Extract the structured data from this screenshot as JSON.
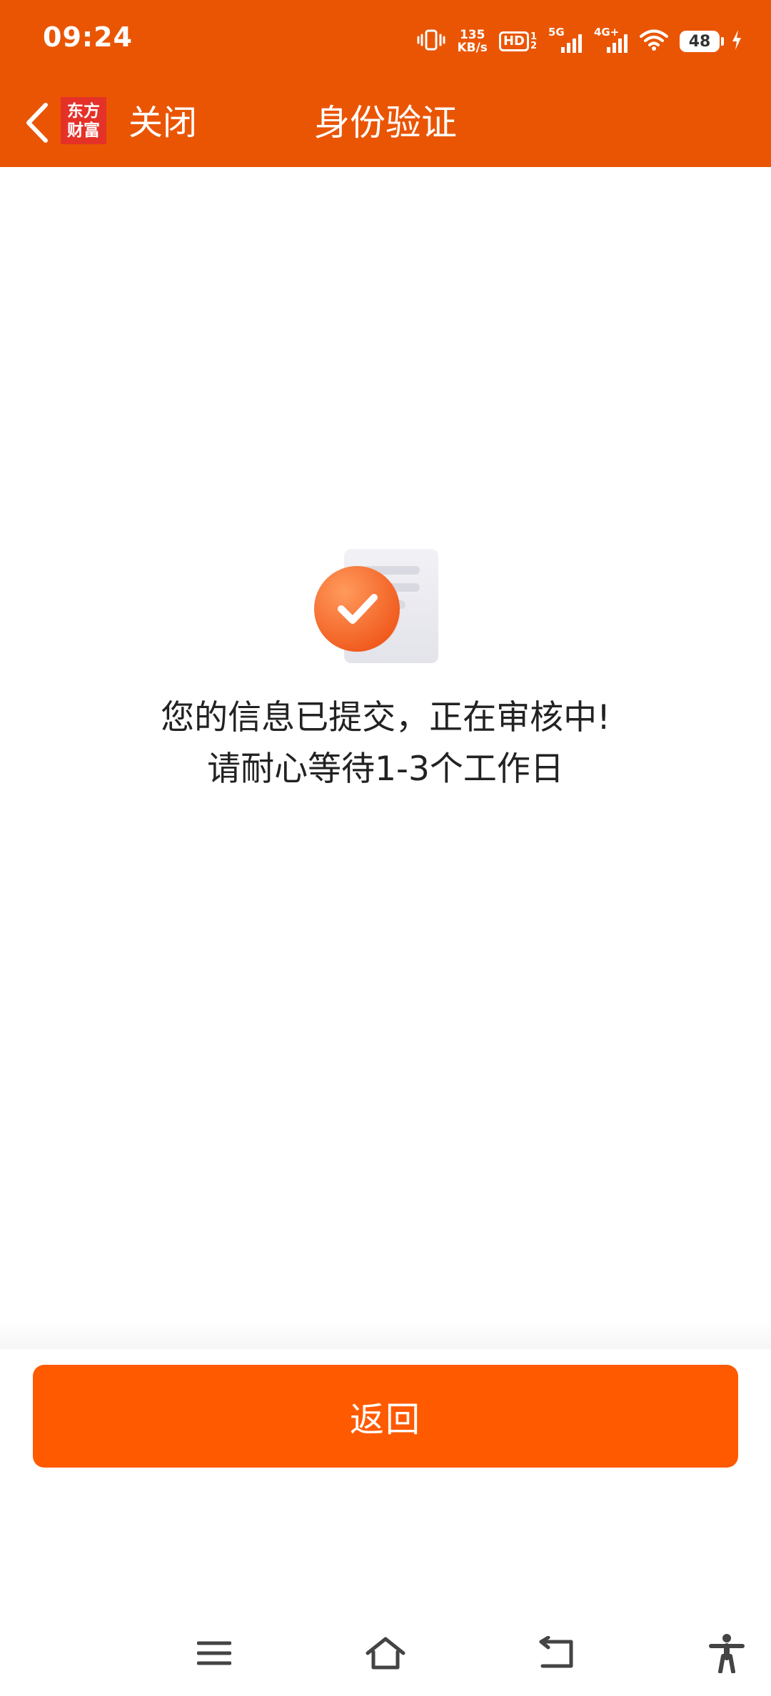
{
  "status_bar": {
    "time": "09:24",
    "net_speed_value": "135",
    "net_speed_unit": "KB/s",
    "hd_label": "HD",
    "sim1_label": "5G",
    "sim2_label": "4G+",
    "battery_level": "48",
    "icons": [
      "vibrate-icon",
      "hd-icon",
      "signal-5g-icon",
      "signal-4g-icon",
      "wifi-icon",
      "battery-icon",
      "charging-icon"
    ]
  },
  "nav": {
    "logo_line1": "东方",
    "logo_line2": "财富",
    "close_label": "关闭",
    "title": "身份验证",
    "back_icon": "chevron-left-icon"
  },
  "content": {
    "message_line1": "您的信息已提交，正在审核中!",
    "message_line2": "请耐心等待1-3个工作日",
    "illustration_icon": "submitted-document-check-icon"
  },
  "footer": {
    "return_label": "返回"
  },
  "system_nav": {
    "icons": [
      "menu-icon",
      "home-icon",
      "back-icon",
      "accessibility-icon"
    ]
  },
  "colors": {
    "header_bg": "#EA5504",
    "button_bg": "#FF5A00",
    "logo_bg": "#E53228",
    "text_primary": "#222222"
  }
}
